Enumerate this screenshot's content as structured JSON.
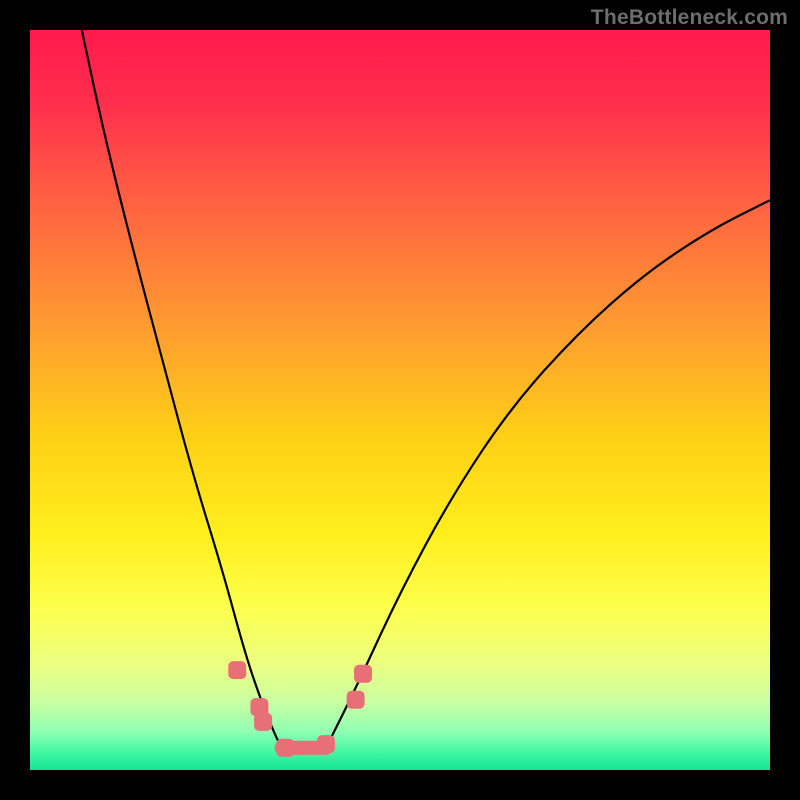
{
  "watermark": "TheBottleneck.com",
  "chart_data": {
    "type": "line",
    "title": "",
    "xlabel": "",
    "ylabel": "",
    "xlim": [
      0,
      1
    ],
    "ylim": [
      0,
      1
    ],
    "grid": false,
    "legend": false,
    "series": [
      {
        "name": "left-branch",
        "note": "V-shape left arm, descends steeply from near top-left toward trough around x≈0.34",
        "x": [
          0.07,
          0.1,
          0.14,
          0.18,
          0.22,
          0.26,
          0.29,
          0.31,
          0.33,
          0.34
        ],
        "values": [
          1.0,
          0.86,
          0.7,
          0.55,
          0.4,
          0.27,
          0.16,
          0.1,
          0.05,
          0.03
        ]
      },
      {
        "name": "right-branch",
        "note": "V-shape right arm, rises from trough x≈0.40 toward upper-right with decreasing slope",
        "x": [
          0.4,
          0.44,
          0.5,
          0.57,
          0.65,
          0.74,
          0.83,
          0.92,
          1.0
        ],
        "values": [
          0.03,
          0.11,
          0.24,
          0.37,
          0.49,
          0.59,
          0.67,
          0.73,
          0.77
        ]
      },
      {
        "name": "cluster",
        "note": "pink marker cluster near trough of V",
        "x": [
          0.28,
          0.31,
          0.315,
          0.345,
          0.4,
          0.44,
          0.45
        ],
        "values": [
          0.135,
          0.085,
          0.065,
          0.03,
          0.035,
          0.095,
          0.13
        ]
      }
    ],
    "background_gradient": {
      "type": "vertical",
      "stops": [
        {
          "pos": 0.0,
          "color": "#ff1a4c"
        },
        {
          "pos": 0.1,
          "color": "#ff2f4c"
        },
        {
          "pos": 0.25,
          "color": "#ff6840"
        },
        {
          "pos": 0.4,
          "color": "#ff9b30"
        },
        {
          "pos": 0.55,
          "color": "#ffd016"
        },
        {
          "pos": 0.68,
          "color": "#ffee1c"
        },
        {
          "pos": 0.78,
          "color": "#fdff4c"
        },
        {
          "pos": 0.86,
          "color": "#eaff82"
        },
        {
          "pos": 0.91,
          "color": "#c7ffa3"
        },
        {
          "pos": 0.95,
          "color": "#8cffb3"
        },
        {
          "pos": 0.975,
          "color": "#44f9a2"
        },
        {
          "pos": 1.0,
          "color": "#13e594"
        }
      ]
    },
    "marker_color": "#e86f76",
    "curve_color": "#000000"
  }
}
